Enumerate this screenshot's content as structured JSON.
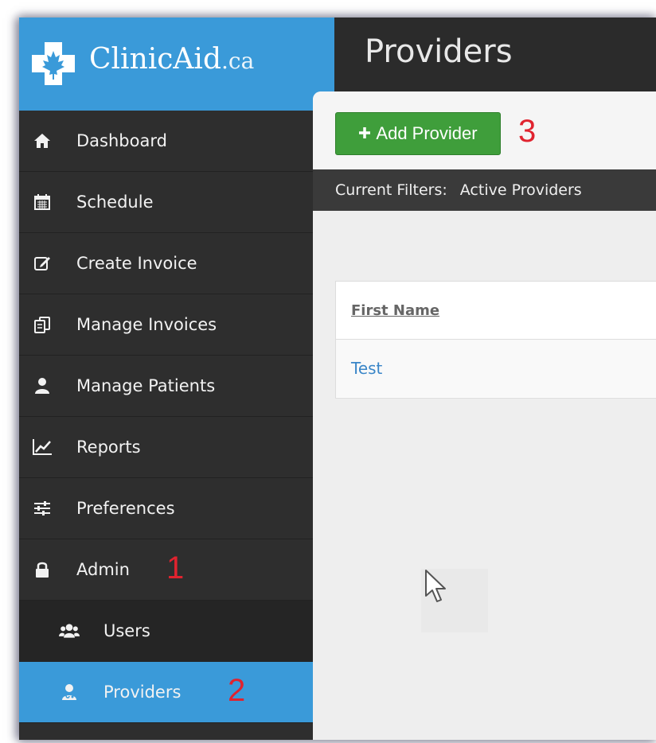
{
  "app": {
    "brand_main": "ClinicAid",
    "brand_tld": ".ca",
    "page_title": "Providers"
  },
  "sidebar": {
    "items": [
      {
        "label": "Dashboard",
        "icon": "home-icon"
      },
      {
        "label": "Schedule",
        "icon": "calendar-icon"
      },
      {
        "label": "Create Invoice",
        "icon": "edit-icon"
      },
      {
        "label": "Manage Invoices",
        "icon": "documents-icon"
      },
      {
        "label": "Manage Patients",
        "icon": "user-icon"
      },
      {
        "label": "Reports",
        "icon": "chart-icon"
      },
      {
        "label": "Preferences",
        "icon": "sliders-icon"
      },
      {
        "label": "Admin",
        "icon": "lock-icon"
      },
      {
        "label": "Users",
        "icon": "users-icon"
      },
      {
        "label": "Providers",
        "icon": "provider-icon"
      }
    ]
  },
  "toolbar": {
    "add_provider_label": "Add Provider"
  },
  "filters": {
    "label": "Current Filters:",
    "value": "Active Providers"
  },
  "table": {
    "columns": [
      "First Name"
    ],
    "rows": [
      [
        "Test"
      ]
    ]
  },
  "annotations": [
    "1",
    "2",
    "3"
  ],
  "colors": {
    "brand_blue": "#3a9ad9",
    "sidebar_bg": "#2e2e2e",
    "button_green": "#3f9e3b",
    "annotation_red": "#e0232f",
    "link_blue": "#3a86c8"
  }
}
